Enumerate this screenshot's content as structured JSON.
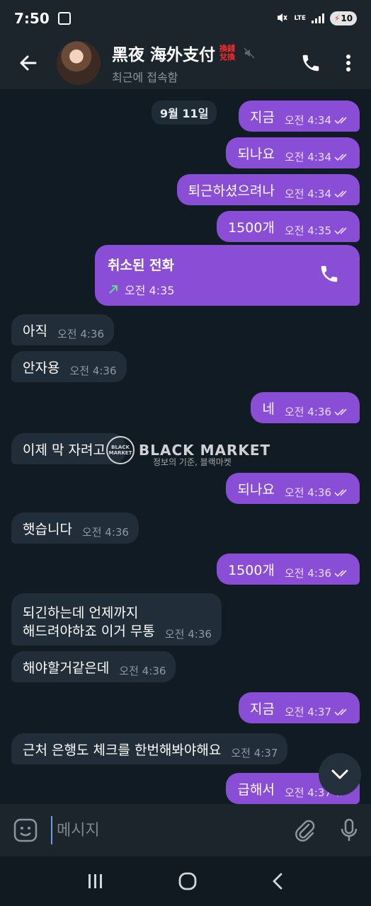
{
  "status_bar": {
    "time": "7:50",
    "network": "LTE",
    "battery": "10"
  },
  "header": {
    "title": "黑夜 海外支付",
    "tag": "換錢 兌換",
    "subtitle": "최근에 접속함"
  },
  "chat": {
    "date": "9월 11일",
    "messages": [
      {
        "dir": "out",
        "text": "지금",
        "time": "오전 4:34",
        "read": true
      },
      {
        "dir": "out",
        "text": "되나요",
        "time": "오전 4:34",
        "read": true
      },
      {
        "dir": "out",
        "text": "퇴근하셨으려나",
        "time": "오전 4:34",
        "read": true
      },
      {
        "dir": "out",
        "text": "1500개",
        "time": "오전 4:35",
        "read": true
      },
      {
        "dir": "in",
        "text": "아직",
        "time": "오전 4:36"
      },
      {
        "dir": "in",
        "text": "안자용",
        "time": "오전 4:36"
      },
      {
        "dir": "out",
        "text": "네",
        "time": "오전 4:36",
        "read": true
      },
      {
        "dir": "in",
        "text": "이제 막 자려고",
        "time": ""
      },
      {
        "dir": "out",
        "text": "되나요",
        "time": "오전 4:36",
        "read": true
      },
      {
        "dir": "in",
        "text": "햇습니다",
        "time": "오전 4:36"
      },
      {
        "dir": "out",
        "text": "1500개",
        "time": "오전 4:36",
        "read": true
      },
      {
        "dir": "in",
        "text": "되긴하는데 언제까지\n해드려야하죠 이거 무통",
        "time": "오전 4:36"
      },
      {
        "dir": "in",
        "text": "해야할거같은데",
        "time": "오전 4:36"
      },
      {
        "dir": "out",
        "text": "지금",
        "time": "오전 4:37",
        "read": true
      },
      {
        "dir": "in",
        "text": "근처 은행도  체크를 한번해봐야해요",
        "time": "오전 4:37"
      },
      {
        "dir": "out",
        "text": "급해서",
        "time": "오전 4:37",
        "read": true
      }
    ],
    "call": {
      "title": "취소된 전화",
      "time": "오전 4:35"
    }
  },
  "watermark": {
    "logo": "BLACK MARKET",
    "text": "BLACK MARKET",
    "sub": "정보의 기준, 블랙마켓"
  },
  "composer": {
    "placeholder": "메시지"
  },
  "colors": {
    "outgoing": "#8a4ed6",
    "incoming": "#212d38",
    "background": "#101b23",
    "header": "#1c242c"
  },
  "icons": [
    "back-arrow-icon",
    "mute-icon",
    "phone-icon",
    "more-icon",
    "emoji-icon",
    "attach-icon",
    "mic-icon",
    "chevron-down-icon",
    "menu-icon",
    "home-icon",
    "back-icon"
  ]
}
